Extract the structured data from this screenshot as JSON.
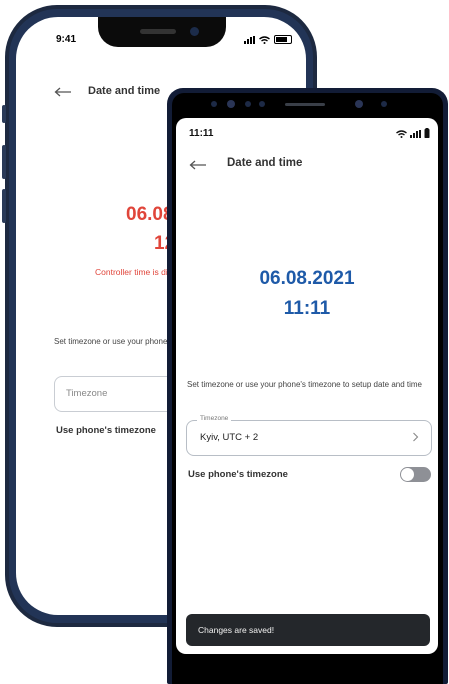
{
  "back_phone": {
    "status_time": "9:41",
    "title": "Date and time",
    "date": "06.08.",
    "time": "12:",
    "warning": "Controller time is diffe",
    "help": "Set timezone or use your phone's time",
    "timezone_placeholder": "Timezone",
    "use_phone_tz_label": "Use phone's timezone"
  },
  "front_phone": {
    "status_time": "11:11",
    "title": "Date and time",
    "date": "06.08.2021",
    "time": "11:11",
    "help": "Set timezone or use your phone's timezone to setup date and time",
    "timezone_label": "Timezone",
    "timezone_value": "Kyiv, UTC + 2",
    "use_phone_tz_label": "Use phone's timezone",
    "use_phone_tz_on": false,
    "toast": "Changes are saved!"
  },
  "colors": {
    "error_red": "#e0453a",
    "accent_blue": "#1e5aa8",
    "toast_bg": "#24272b"
  },
  "icons": [
    "back-arrow-icon",
    "chevron-right-icon",
    "wifi-icon",
    "signal-icon",
    "battery-icon"
  ]
}
